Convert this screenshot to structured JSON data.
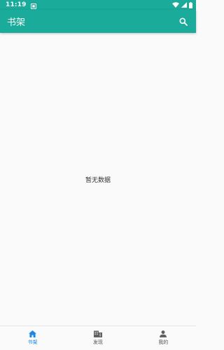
{
  "status_bar": {
    "time": "11:19",
    "icons": [
      "notification-icon",
      "wifi-icon",
      "signal-icon",
      "battery-icon"
    ]
  },
  "app_bar": {
    "title": "书架",
    "search_icon": "search-icon"
  },
  "content": {
    "empty_message": "暂无数据"
  },
  "bottom_nav": {
    "items": [
      {
        "label": "书架",
        "icon": "home-icon",
        "active": true
      },
      {
        "label": "发现",
        "icon": "discover-icon",
        "active": false
      },
      {
        "label": "我的",
        "icon": "person-icon",
        "active": false
      }
    ]
  },
  "colors": {
    "primary": "#1aab9b",
    "active_nav": "#1e88e5",
    "inactive_nav": "#555555",
    "background": "#fafafa"
  }
}
